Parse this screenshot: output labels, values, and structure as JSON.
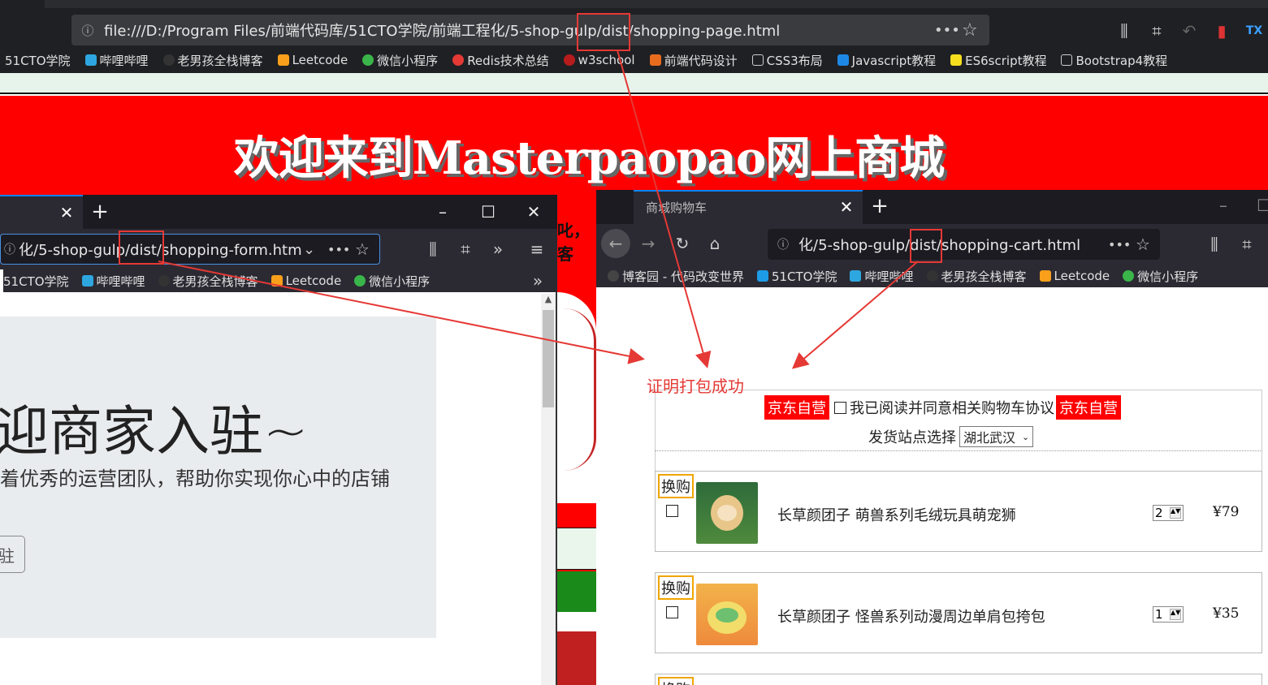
{
  "main_browser": {
    "url": "file:///D:/Program Files/前端代码库/51CTO学院/前端工程化/5-shop-gulp/dist/shopping-page.html",
    "bookmarks": [
      "51CTO学院",
      "哔哩哔哩",
      "老男孩全栈博客",
      "Leetcode",
      "微信小程序",
      "Redis技术总结",
      "w3school",
      "前端代码设计",
      "CSS3布局",
      "Javascript教程",
      "ES6script教程",
      "Bootstrap4教程"
    ],
    "banner_title": "欢迎来到Masterpaopao网上商城"
  },
  "left_window": {
    "url": "化/5-shop-gulp/dist/shopping-form.html",
    "bookmarks": [
      "51CTO学院",
      "哔哩哔哩",
      "老男孩全栈博客",
      "Leetcode",
      "微信小程序"
    ],
    "heading": "迎商家入驻~",
    "subtext": "着优秀的运营团队，帮助你实现你心中的店铺",
    "button_text": "驻"
  },
  "right_window": {
    "tab_title": "商城购物车",
    "url": "化/5-shop-gulp/dist/shopping-cart.html",
    "bookmarks": [
      "博客园 - 代码改变世界",
      "51CTO学院",
      "哔哩哔哩",
      "老男孩全栈博客",
      "Leetcode",
      "微信小程序"
    ],
    "jd_label": "京东自营",
    "agreement": "我已阅读并同意相关购物车协议",
    "station_label": "发货站点选择",
    "station_value": "湖北武汉",
    "items": [
      {
        "tag": "换购",
        "name": "长草颜团子 萌兽系列毛绒玩具萌宠狮",
        "qty": "2",
        "price": "¥79"
      },
      {
        "tag": "换购",
        "name": "长草颜团子 怪兽系列动漫周边单肩包挎包",
        "qty": "1",
        "price": "¥35"
      },
      {
        "tag": "换购"
      }
    ]
  },
  "annotation": "证明打包成功",
  "bg_partial": "叱，客",
  "colors": {
    "accent": "#e53935",
    "banner": "#ff0000"
  }
}
